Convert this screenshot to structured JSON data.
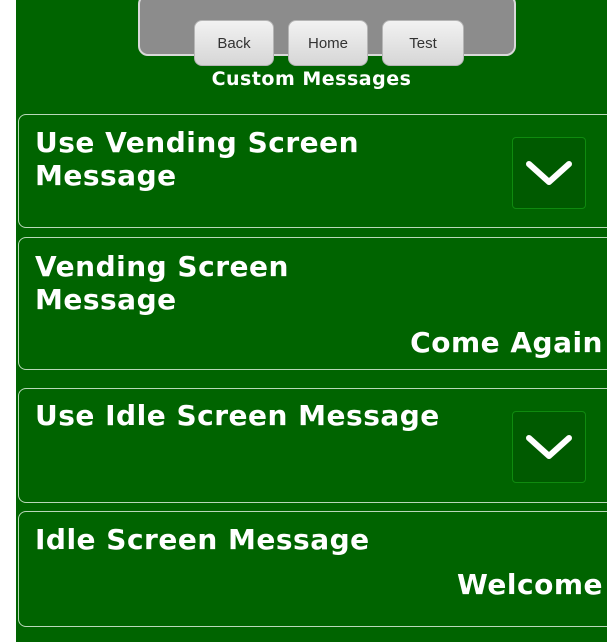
{
  "nav": {
    "back_label": "Back",
    "home_label": "Home",
    "test_label": "Test"
  },
  "page": {
    "title": "Custom Messages"
  },
  "rows": [
    {
      "label_line1": "Use Vending Screen",
      "label_line2": "Message",
      "type": "checkbox",
      "checked": true,
      "icon": "checkmark-icon"
    },
    {
      "label_line1": "Vending Screen",
      "label_line2": "Message",
      "type": "text",
      "value": "Come Again"
    },
    {
      "label_line1": "Use Idle Screen Message",
      "type": "checkbox",
      "checked": true,
      "icon": "checkmark-icon"
    },
    {
      "label_line1": "Idle Screen Message",
      "type": "text",
      "value": "Welcome"
    }
  ],
  "colors": {
    "background": "#006400",
    "row_border": "#b9d8b9",
    "text": "#ffffff",
    "nav_tray": "#8c8c8c",
    "nav_button": "#e6e6e6"
  }
}
